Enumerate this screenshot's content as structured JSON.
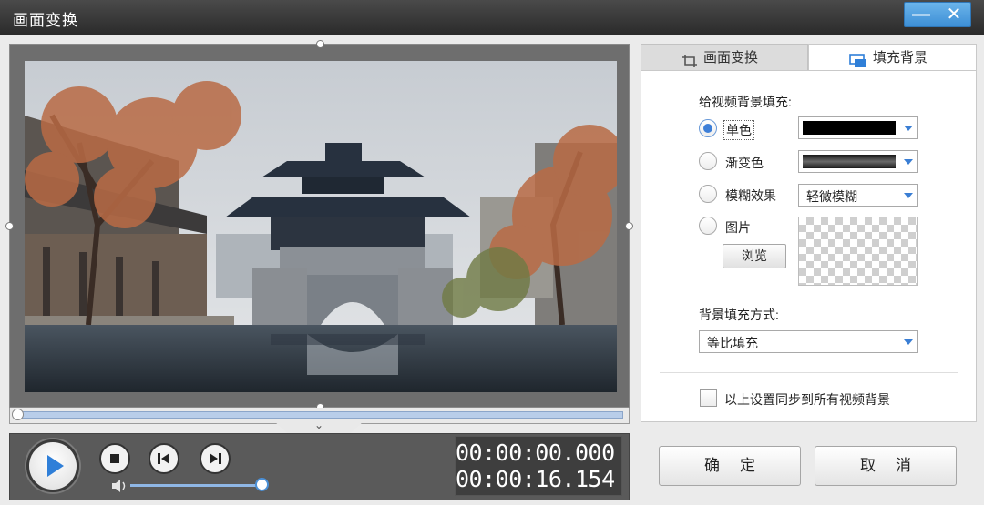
{
  "window": {
    "title": "画面变换",
    "minimize_label": "—",
    "close_label": "✕"
  },
  "tabs": [
    {
      "label": "画面变换",
      "icon": "crop-icon",
      "active": false
    },
    {
      "label": "填充背景",
      "icon": "fill-background-icon",
      "active": true
    }
  ],
  "fill": {
    "section_label": "给视频背景填充:",
    "options": [
      {
        "label": "单色",
        "selected": true
      },
      {
        "label": "渐变色",
        "selected": false
      },
      {
        "label": "模糊效果",
        "selected": false
      },
      {
        "label": "图片",
        "selected": false
      }
    ],
    "solid_color": "#000000",
    "gradient_colors": [
      "#1a1a1a",
      "#6a6a6a"
    ],
    "blur_value": "轻微模糊",
    "browse_label": "浏览"
  },
  "mode": {
    "label": "背景填充方式:",
    "value": "等比填充"
  },
  "sync": {
    "label": "以上设置同步到所有视频背景",
    "checked": false
  },
  "player": {
    "current_time": "00:00:00.000",
    "total_time": "00:00:16.154",
    "timeline_progress": 0,
    "volume_level": 1.0
  },
  "buttons": {
    "ok": "确定",
    "cancel": "取消"
  },
  "colors": {
    "accent": "#3d7fd8",
    "titlebar": "#2b2b2b"
  }
}
